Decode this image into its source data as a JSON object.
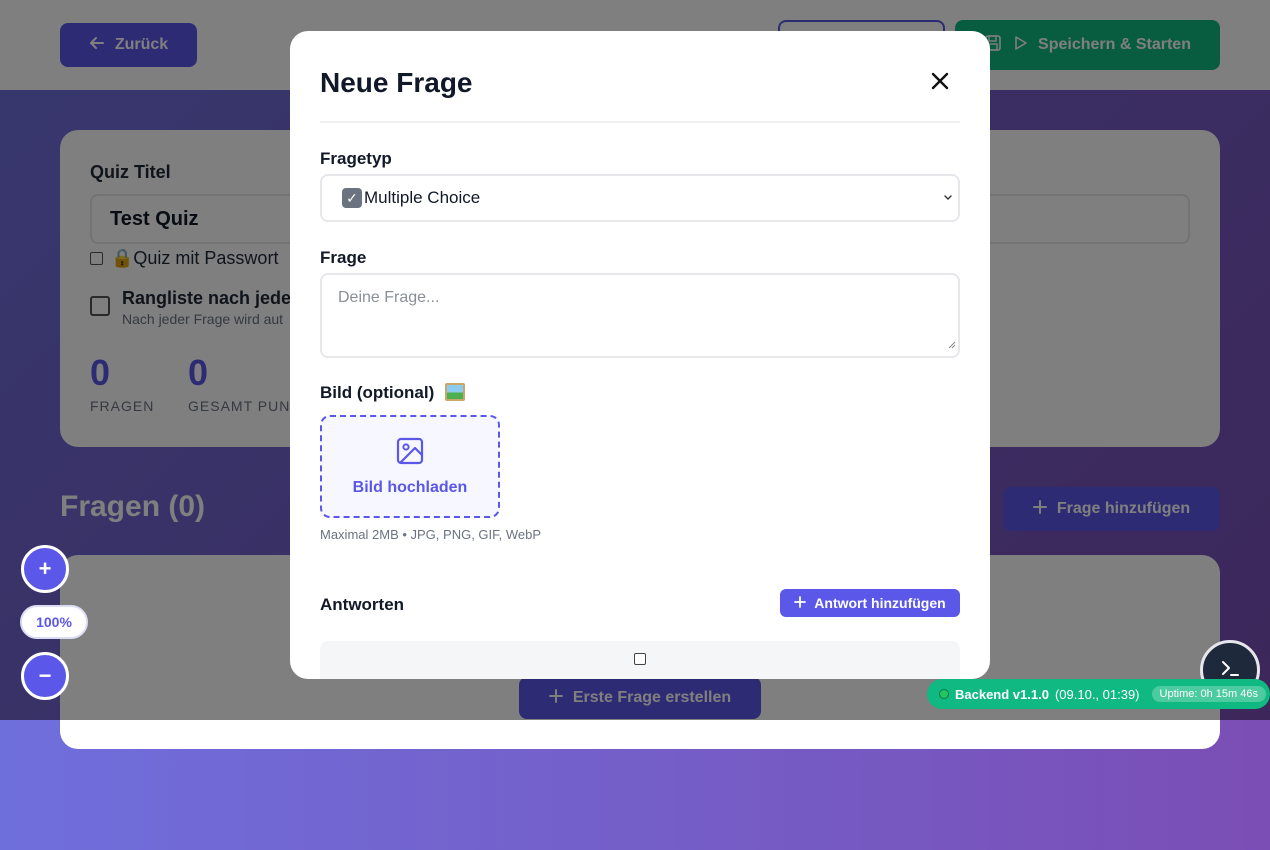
{
  "header": {
    "back_label": "Zurück",
    "save_start_label": "Speichern & Starten"
  },
  "quiz": {
    "title_label": "Quiz Titel",
    "title_value": "Test Quiz",
    "password_label": "🔒Quiz mit Passwort",
    "leaderboard_title": "Rangliste nach jede",
    "leaderboard_sub": "Nach jeder Frage wird aut"
  },
  "stats": [
    {
      "value": "0",
      "label": "FRAGEN"
    },
    {
      "value": "0",
      "label": "GESAMT PUNK"
    }
  ],
  "questions": {
    "heading": "Fragen (0)",
    "add_label": "Frage hinzufügen",
    "first_label": "Erste Frage erstellen"
  },
  "zoom": {
    "plus": "+",
    "level": "100%",
    "minus": "−"
  },
  "backend": {
    "name": "Backend v1.1.0",
    "date": "(09.10., 01:39)",
    "uptime": "Uptime: 0h 15m 46s"
  },
  "modal": {
    "title": "Neue Frage",
    "type_label": "Fragetyp",
    "type_value": "Multiple Choice",
    "question_label": "Frage",
    "question_placeholder": "Deine Frage...",
    "image_label": "Bild (optional)",
    "upload_label": "Bild hochladen",
    "upload_hint": "Maximal 2MB • JPG, PNG, GIF, WebP",
    "answers_label": "Antworten",
    "add_answer_label": "Antwort hinzufügen"
  },
  "colors": {
    "accent": "#5b57e8",
    "success": "#10b981"
  }
}
